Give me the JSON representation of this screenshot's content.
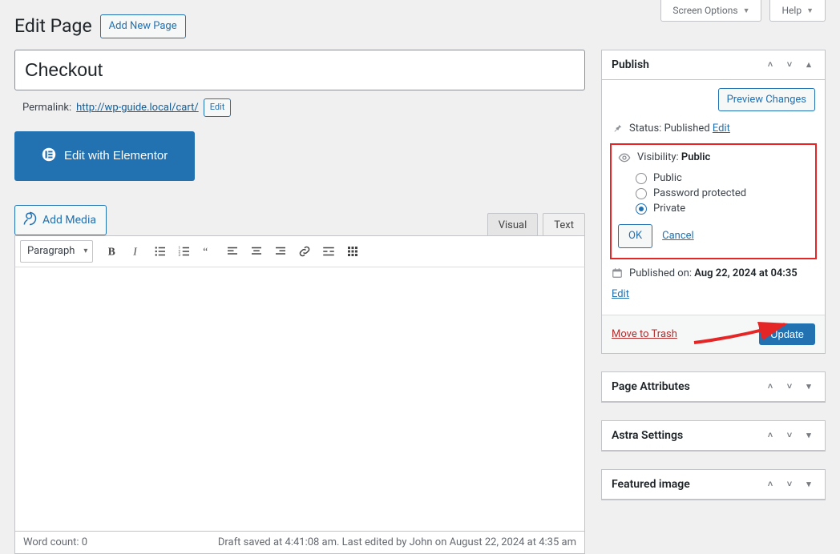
{
  "screen_options_label": "Screen Options",
  "help_label": "Help",
  "page_heading": "Edit Page",
  "add_new_label": "Add New Page",
  "title_value": "Checkout",
  "permalink_label": "Permalink:",
  "permalink_url": "http://wp-guide.local/cart/",
  "permalink_edit": "Edit",
  "elementor_label": "Edit with Elementor",
  "add_media_label": "Add Media",
  "editor_tabs": {
    "visual": "Visual",
    "text": "Text"
  },
  "format_selected": "Paragraph",
  "footer_word_count": "Word count: 0",
  "footer_draft": "Draft saved at 4:41:08 am. Last edited by John on August 22, 2024 at 4:35 am",
  "publish": {
    "box_title": "Publish",
    "preview_label": "Preview Changes",
    "status_label": "Status:",
    "status_value": "Published",
    "status_edit": "Edit",
    "visibility_label": "Visibility:",
    "visibility_value": "Public",
    "options": {
      "public": "Public",
      "password": "Password protected",
      "private": "Private"
    },
    "ok": "OK",
    "cancel": "Cancel",
    "published_on_label": "Published on:",
    "published_on_value": "Aug 22, 2024 at 04:35",
    "published_on_edit": "Edit",
    "trash": "Move to Trash",
    "update": "Update"
  },
  "boxes": {
    "page_attributes": "Page Attributes",
    "astra_settings": "Astra Settings",
    "featured_image": "Featured image"
  }
}
